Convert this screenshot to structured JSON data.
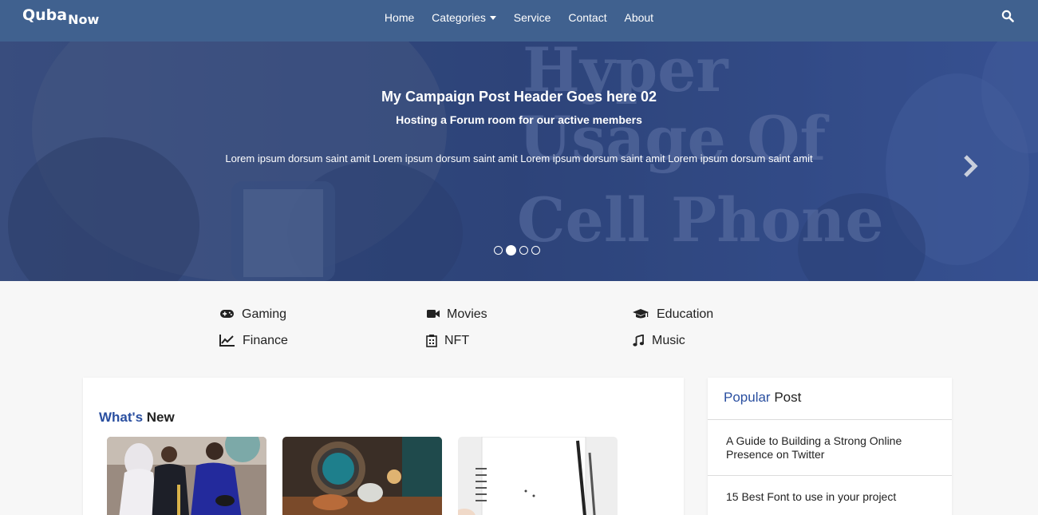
{
  "brand": {
    "part1": "Quba",
    "part2": "Now"
  },
  "nav": {
    "home": "Home",
    "categories": "Categories",
    "service": "Service",
    "contact": "Contact",
    "about": "About"
  },
  "hero": {
    "title": "My Campaign Post Header Goes here 02",
    "subtitle": "Hosting a Forum room for our active members",
    "text": "Lorem ipsum dorsum saint amit Lorem ipsum dorsum saint amit Lorem ipsum dorsum saint amit Lorem ipsum dorsum saint amit",
    "bg_text": [
      "Hyper",
      "Usage Of",
      "Cell Phone"
    ],
    "active_slide": 2,
    "slide_count": 4
  },
  "categories": [
    {
      "label": "Gaming",
      "icon": "gamepad-icon"
    },
    {
      "label": "Movies",
      "icon": "video-camera-icon"
    },
    {
      "label": "Education",
      "icon": "graduation-cap-icon"
    },
    {
      "label": "Finance",
      "icon": "line-chart-icon"
    },
    {
      "label": "NFT",
      "icon": "nft-icon"
    },
    {
      "label": "Music",
      "icon": "music-note-icon"
    }
  ],
  "whats_new": {
    "title_accent": "What's",
    "title_rest": "New"
  },
  "popular": {
    "title_accent": "Popular",
    "title_rest": "Post",
    "items": [
      "A Guide to Building a Strong Online Presence on Twitter",
      "15 Best Font to use in your project"
    ]
  },
  "colors": {
    "navbar": "#40618f",
    "accent": "#2a4fa0",
    "hero_overlay": "#2f477e"
  }
}
